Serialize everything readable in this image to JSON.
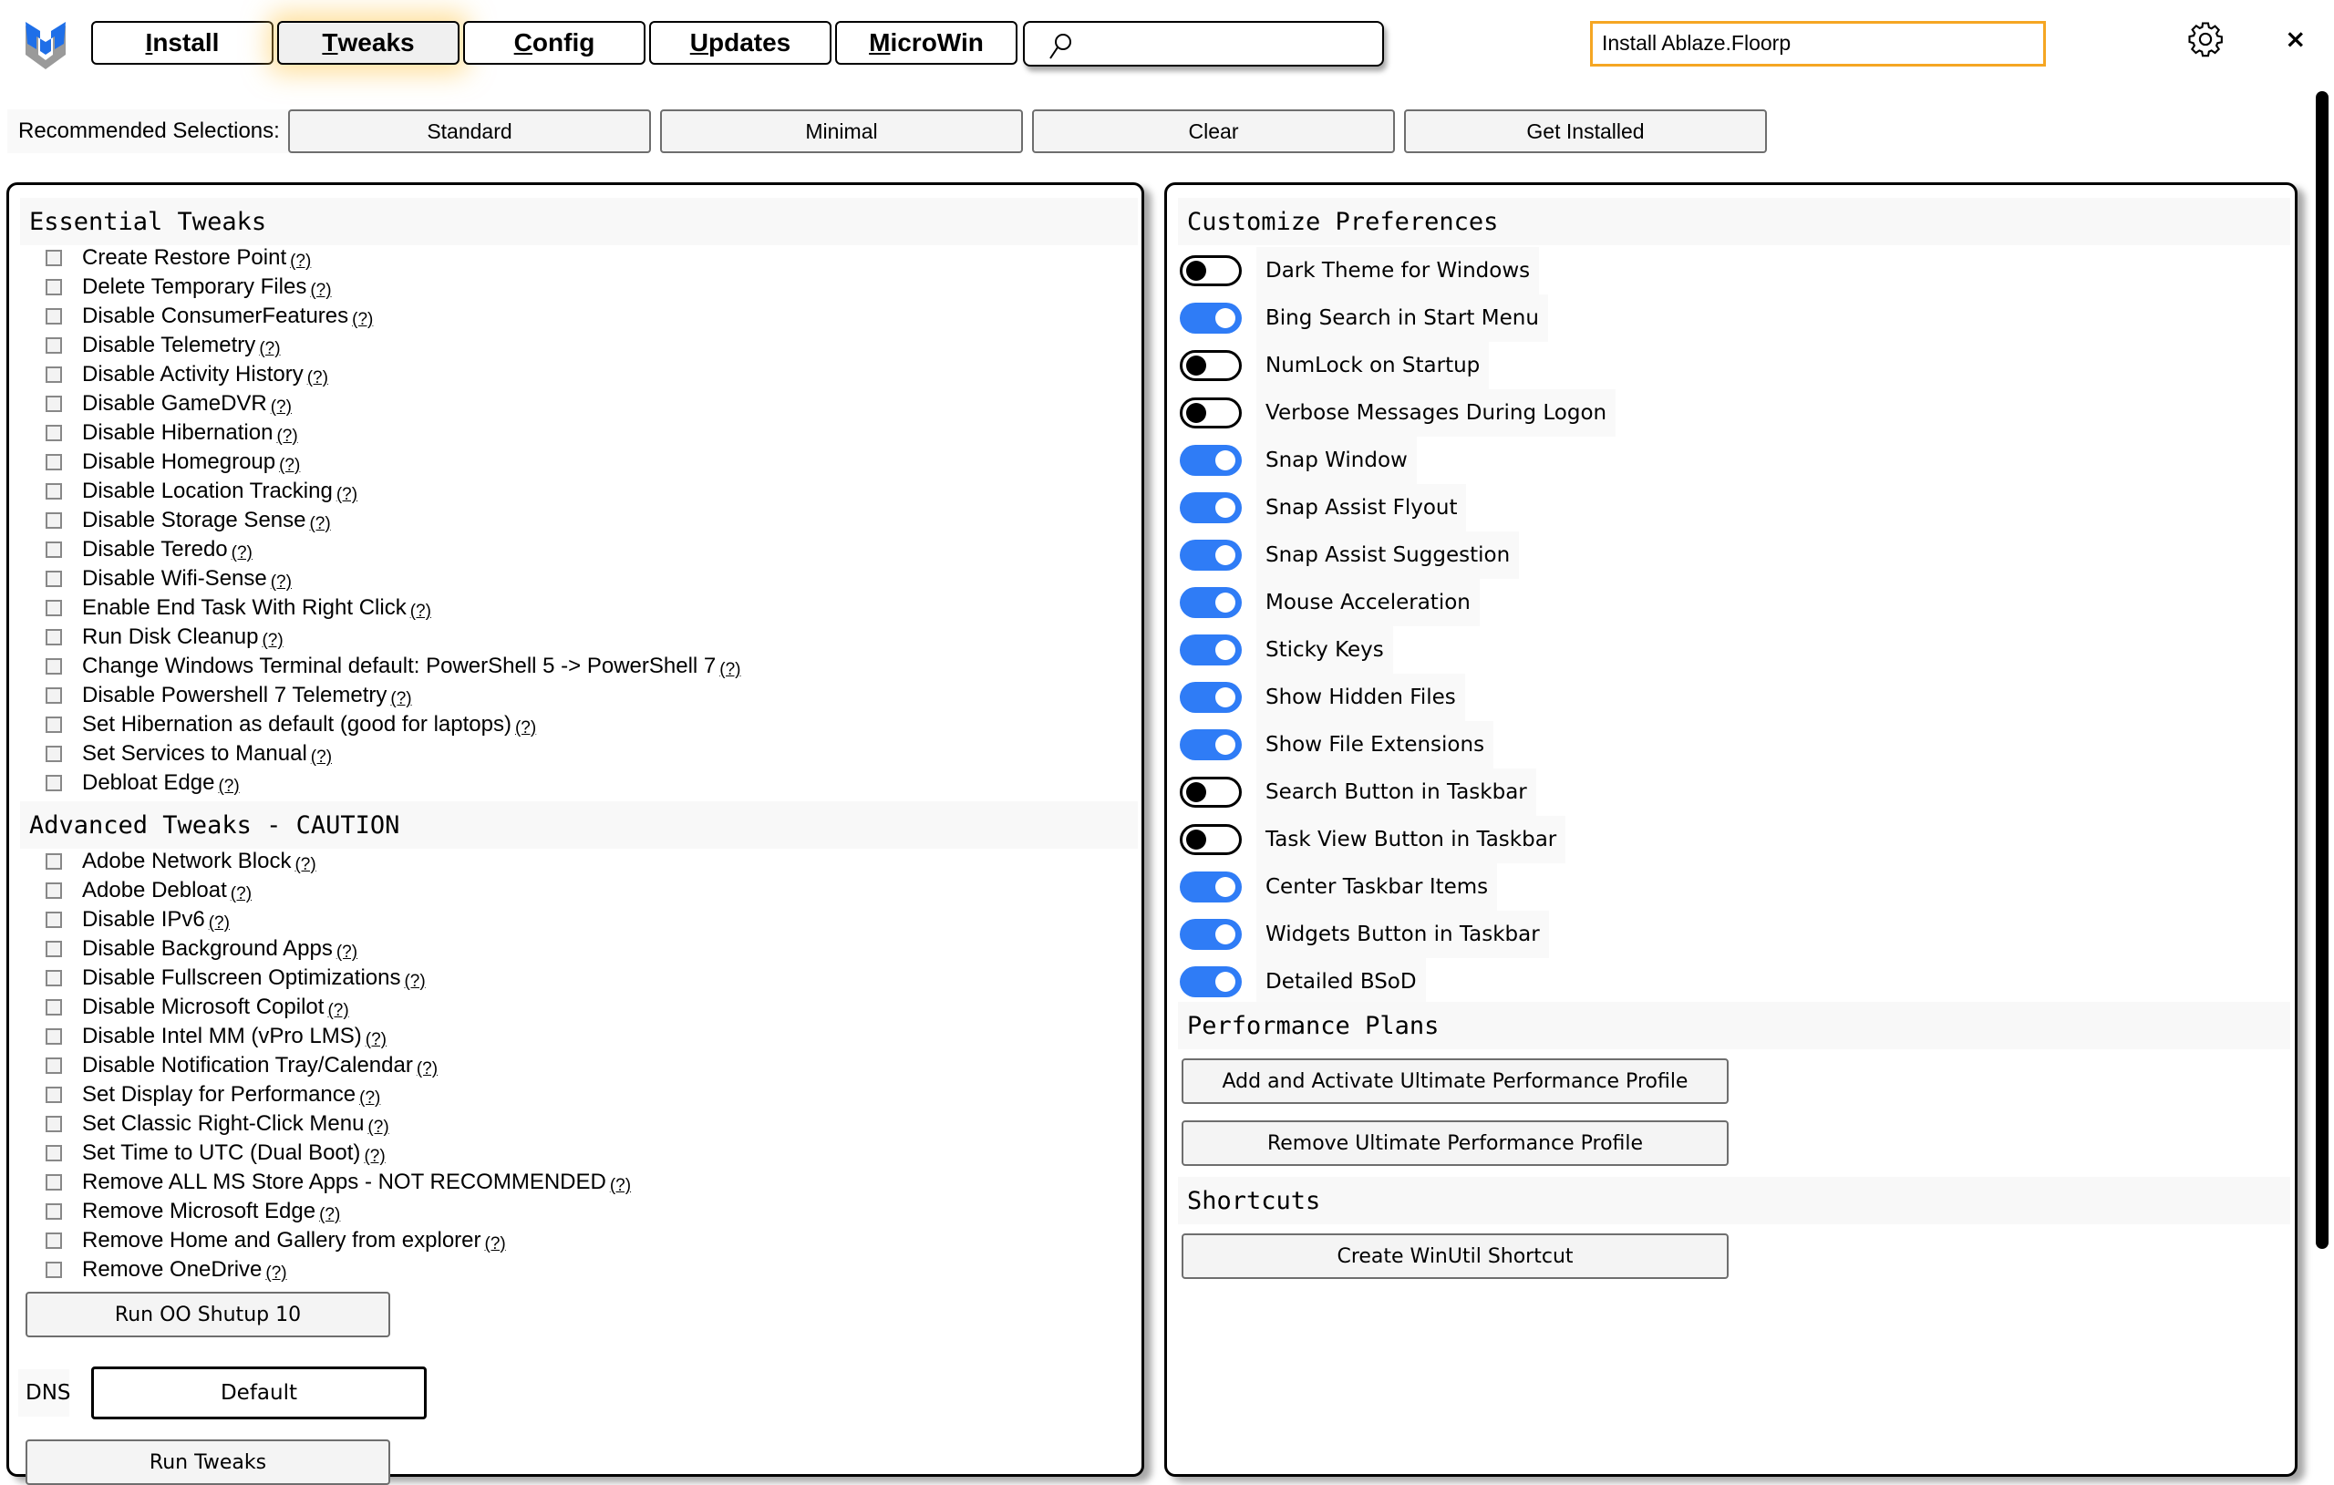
{
  "header": {
    "tabs": [
      {
        "label": "Install",
        "accel": "I",
        "rest": "nstall",
        "active": false
      },
      {
        "label": "Tweaks",
        "accel": "T",
        "rest": "weaks",
        "active": true
      },
      {
        "label": "Config",
        "accel": "C",
        "rest": "onfig",
        "active": false
      },
      {
        "label": "Updates",
        "accel": "U",
        "rest": "pdates",
        "active": false
      },
      {
        "label": "MicroWin",
        "accel": "M",
        "rest": "icroWin",
        "active": false
      }
    ],
    "search": {
      "value": "",
      "placeholder": ""
    },
    "status_text": "Install Ablaze.Floorp",
    "icons": {
      "logo": "winutil-logo",
      "search": "search-icon",
      "settings": "gear-icon",
      "close": "close-icon"
    },
    "close_glyph": "×"
  },
  "recommended": {
    "label": "Recommended Selections:",
    "buttons": [
      "Standard",
      "Minimal",
      "Clear",
      "Get Installed"
    ]
  },
  "left": {
    "essential": {
      "title": "Essential Tweaks",
      "items": [
        "Create Restore Point",
        "Delete Temporary Files",
        "Disable ConsumerFeatures",
        "Disable Telemetry",
        "Disable Activity History",
        "Disable GameDVR",
        "Disable Hibernation",
        "Disable Homegroup",
        "Disable Location Tracking",
        "Disable Storage Sense",
        "Disable Teredo",
        "Disable Wifi-Sense",
        "Enable End Task With Right Click",
        "Run Disk Cleanup",
        "Change Windows Terminal default: PowerShell 5 -> PowerShell 7",
        "Disable Powershell 7 Telemetry",
        "Set Hibernation as default (good for laptops)",
        "Set Services to Manual",
        "Debloat Edge"
      ]
    },
    "advanced": {
      "title": "Advanced Tweaks - CAUTION",
      "items": [
        "Adobe Network Block",
        "Adobe Debloat",
        "Disable IPv6",
        "Disable Background Apps",
        "Disable Fullscreen Optimizations",
        "Disable Microsoft Copilot",
        "Disable Intel MM (vPro LMS)",
        "Disable Notification Tray/Calendar",
        "Set Display for Performance",
        "Set Classic Right-Click Menu ",
        "Set Time to UTC (Dual Boot)",
        "Remove ALL MS Store Apps - NOT RECOMMENDED",
        "Remove Microsoft Edge",
        "Remove Home and Gallery from explorer",
        "Remove OneDrive"
      ]
    },
    "help_text": "(?)",
    "oo_button": "Run OO Shutup 10",
    "dns": {
      "label": "DNS",
      "value": "Default"
    },
    "run_button": "Run Tweaks"
  },
  "right": {
    "preferences": {
      "title": "Customize Preferences",
      "items": [
        {
          "label": "Dark Theme for Windows",
          "on": false
        },
        {
          "label": "Bing Search in Start Menu",
          "on": true
        },
        {
          "label": "NumLock on Startup",
          "on": false
        },
        {
          "label": "Verbose Messages During Logon",
          "on": false
        },
        {
          "label": "Snap Window",
          "on": true
        },
        {
          "label": "Snap Assist Flyout",
          "on": true
        },
        {
          "label": "Snap Assist Suggestion",
          "on": true
        },
        {
          "label": "Mouse Acceleration",
          "on": true
        },
        {
          "label": "Sticky Keys",
          "on": true
        },
        {
          "label": "Show Hidden Files",
          "on": true
        },
        {
          "label": "Show File Extensions",
          "on": true
        },
        {
          "label": "Search Button in Taskbar",
          "on": false
        },
        {
          "label": "Task View Button in Taskbar",
          "on": false
        },
        {
          "label": "Center Taskbar Items",
          "on": true
        },
        {
          "label": "Widgets Button in Taskbar",
          "on": true
        },
        {
          "label": "Detailed BSoD",
          "on": true
        }
      ]
    },
    "performance": {
      "title": "Performance Plans",
      "buttons": [
        "Add and Activate Ultimate Performance Profile",
        "Remove Ultimate Performance Profile"
      ]
    },
    "shortcuts": {
      "title": "Shortcuts",
      "buttons": [
        "Create WinUtil Shortcut"
      ]
    }
  },
  "colors": {
    "accent": "#2f7cf6",
    "status_border": "#f5a623",
    "active_glow": "#ffc850"
  }
}
